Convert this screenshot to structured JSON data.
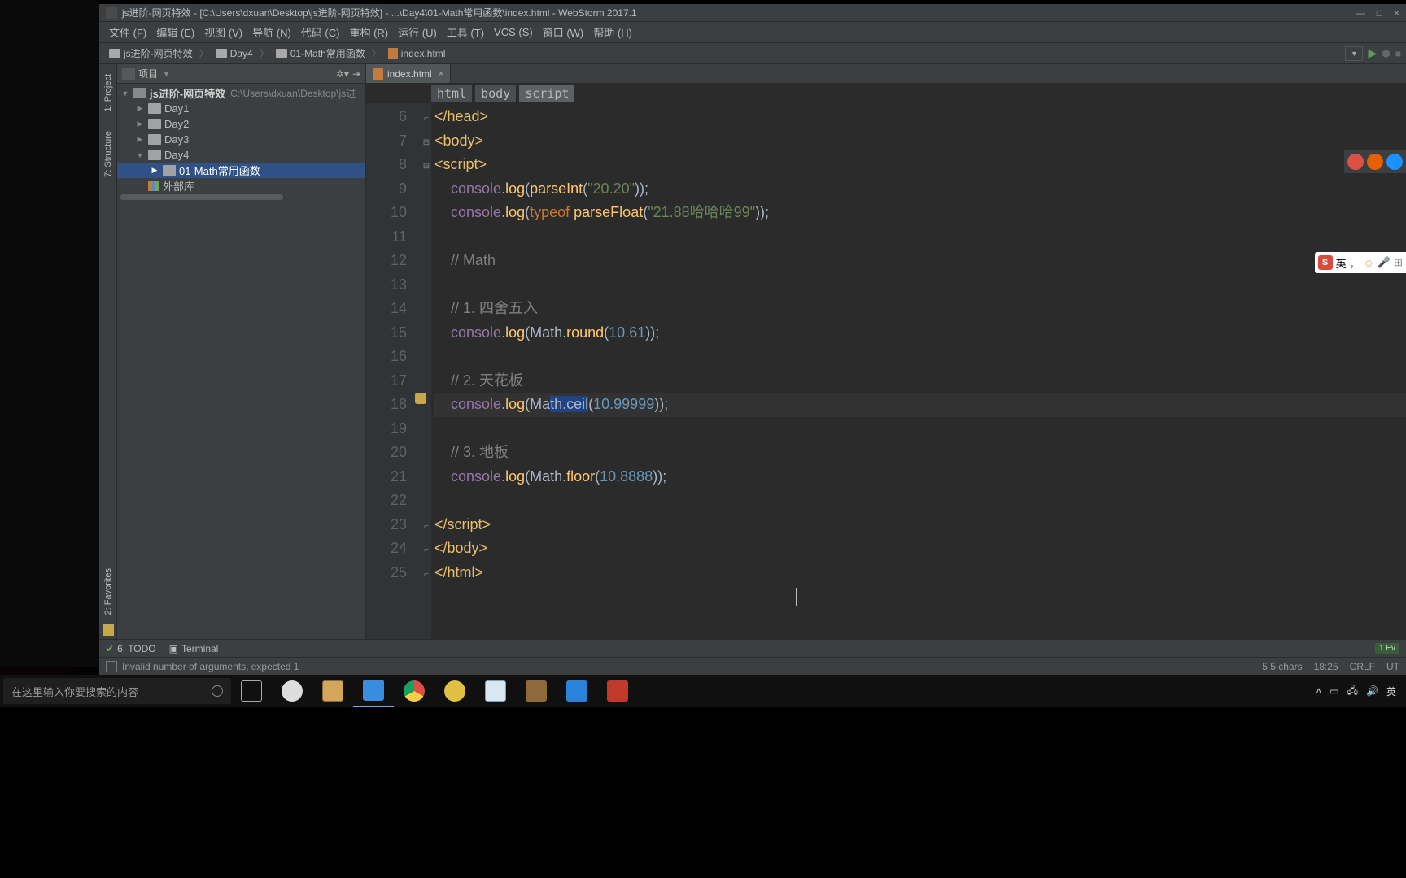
{
  "titlebar": {
    "text": "js进阶-网页特效 - [C:\\Users\\dxuan\\Desktop\\js进阶-网页特效] - ...\\Day4\\01-Math常用函数\\index.html - WebStorm 2017.1",
    "minimize": "—",
    "maximize": "□",
    "close": "×"
  },
  "menu": {
    "file": "文件 (F)",
    "edit": "编辑 (E)",
    "view": "视图 (V)",
    "nav": "导航 (N)",
    "code": "代码 (C)",
    "refactor": "重构 (R)",
    "run": "运行 (U)",
    "tools": "工具 (T)",
    "vcs": "VCS (S)",
    "window": "窗口 (W)",
    "help": "帮助 (H)"
  },
  "breadcrumb": {
    "b1": "js进阶-网页特效",
    "b2": "Day4",
    "b3": "01-Math常用函数",
    "b4": "index.html"
  },
  "left_tabs": {
    "project": "1: Project",
    "structure": "7: Structure",
    "favorites": "2: Favorites"
  },
  "project_panel": {
    "title": "项目",
    "root": "js进阶-网页特效",
    "root_path": "C:\\Users\\dxuan\\Desktop\\js进",
    "day1": "Day1",
    "day2": "Day2",
    "day3": "Day3",
    "day4": "Day4",
    "math": "01-Math常用函数",
    "ext_lib": "外部库"
  },
  "tab": {
    "name": "index.html"
  },
  "crumbs": {
    "c1": "html",
    "c2": "body",
    "c3": "script"
  },
  "gutter": [
    "6",
    "7",
    "8",
    "9",
    "10",
    "11",
    "12",
    "13",
    "14",
    "15",
    "16",
    "17",
    "18",
    "19",
    "20",
    "21",
    "22",
    "23",
    "24",
    "25"
  ],
  "code": {
    "l6": "</head>",
    "l7": "<body>",
    "l8": "<script>",
    "l9_a": "console",
    "l9_b": ".",
    "l9_c": "log",
    "l9_d": "(",
    "l9_e": "parseInt",
    "l9_f": "(",
    "l9_g": "\"20.20\"",
    "l9_h": "));",
    "l10_a": "console",
    "l10_b": ".",
    "l10_c": "log",
    "l10_d": "(",
    "l10_e": "typeof ",
    "l10_f": "parseFloat",
    "l10_g": "(",
    "l10_h": "\"21.88哈哈哈99\"",
    "l10_i": "));",
    "l12": "// Math",
    "l14": "// 1. 四舍五入",
    "l15_a": "console",
    "l15_b": ".",
    "l15_c": "log",
    "l15_d": "(Math.",
    "l15_e": "round",
    "l15_f": "(",
    "l15_g": "10.61",
    "l15_h": "));",
    "l17": "// 2. 天花板",
    "l18_a": "console",
    "l18_b": ".",
    "l18_c": "log",
    "l18_d": "(Ma",
    "l18_sel": "th.ceil",
    "l18_e": "(",
    "l18_f": "10.99999",
    "l18_g": "));",
    "l20": "// 3. 地板",
    "l21_a": "console",
    "l21_b": ".",
    "l21_c": "log",
    "l21_d": "(Math.",
    "l21_e": "floor",
    "l21_f": "(",
    "l21_g": "10.8888",
    "l21_h": "));",
    "l23_a": "</",
    "l23_b": "script",
    "l23_c": ">",
    "l24": "</body>",
    "l25": "</html>"
  },
  "bottom": {
    "todo": "6: TODO",
    "terminal": "Terminal",
    "events": "1 Ev"
  },
  "status": {
    "msg": "Invalid number of arguments, expected 1",
    "chars": "5 5 chars",
    "pos": "18:25",
    "eol": "CRLF",
    "enc": "UT"
  },
  "taskbar": {
    "search_placeholder": "在这里输入你要搜索的内容",
    "ime": "英"
  },
  "ime_float": {
    "lang": "英",
    "comma": "，"
  },
  "colors": {
    "chrome": "#dd5144",
    "firefox": "#e66000",
    "safari": "#1e90ff",
    "cortana": "#0078d7",
    "folder": "#d4a55a",
    "webstorm": "#3a8dde",
    "chrome_tb": "#4c8bf5",
    "spinner": "#e0c040",
    "notepad": "#5dade2",
    "game": "#8e6a3a",
    "files": "#2a82da",
    "rec": "#c0392b"
  }
}
